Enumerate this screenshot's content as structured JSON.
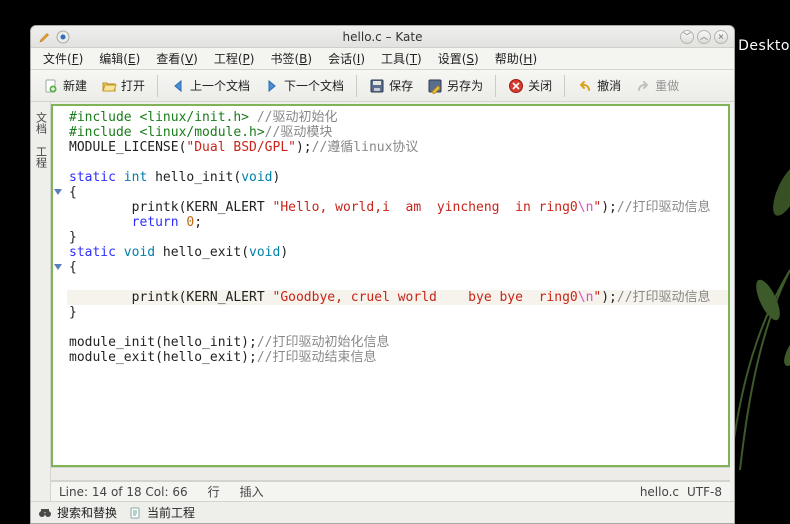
{
  "desktop_label": "Deskto",
  "title": "hello.c – Kate",
  "title_icons": {
    "edit": "pencil-icon",
    "app": "kate-icon"
  },
  "menus": [
    {
      "label": "文件",
      "accel": "F"
    },
    {
      "label": "编辑",
      "accel": "E"
    },
    {
      "label": "查看",
      "accel": "V"
    },
    {
      "label": "工程",
      "accel": "P"
    },
    {
      "label": "书签",
      "accel": "B"
    },
    {
      "label": "会话",
      "accel": "I"
    },
    {
      "label": "工具",
      "accel": "T"
    },
    {
      "label": "设置",
      "accel": "S"
    },
    {
      "label": "帮助",
      "accel": "H"
    }
  ],
  "toolbar": {
    "new": "新建",
    "open": "打开",
    "back": "上一个文档",
    "forward": "下一个文档",
    "save": "保存",
    "saveas": "另存为",
    "close": "关闭",
    "undo": "撤消",
    "redo": "重做"
  },
  "sidebar": {
    "tab1": "文档",
    "tab2": "工程"
  },
  "code": {
    "current_line_index": 13,
    "lines": [
      [
        {
          "c": "kw-pp",
          "t": "#include <linux/init.h>"
        },
        " ",
        {
          "c": "cmt",
          "t": "//驱动初始化"
        }
      ],
      [
        {
          "c": "kw-pp",
          "t": "#include <linux/module.h>"
        },
        {
          "c": "cmt",
          "t": "//驱动模块"
        }
      ],
      [
        "MODULE_LICENSE(",
        {
          "c": "str",
          "t": "\"Dual BSD/GPL\""
        },
        ");",
        {
          "c": "cmt",
          "t": "//遵循linux协议"
        }
      ],
      [
        ""
      ],
      [
        {
          "c": "kw",
          "t": "static"
        },
        " ",
        {
          "c": "type",
          "t": "int"
        },
        " hello_init(",
        {
          "c": "type",
          "t": "void"
        },
        ")"
      ],
      [
        "{"
      ],
      [
        "        printk(KERN_ALERT ",
        {
          "c": "str",
          "t": "\"Hello, world,i  am  yincheng  in ring0"
        },
        {
          "c": "esc",
          "t": "\\n"
        },
        {
          "c": "str",
          "t": "\""
        },
        ");",
        {
          "c": "cmt",
          "t": "//打印驱动信息"
        }
      ],
      [
        "        ",
        {
          "c": "kw",
          "t": "return"
        },
        " ",
        {
          "c": "num",
          "t": "0"
        },
        ";"
      ],
      [
        "}"
      ],
      [
        {
          "c": "kw",
          "t": "static"
        },
        " ",
        {
          "c": "type",
          "t": "void"
        },
        " hello_exit(",
        {
          "c": "type",
          "t": "void"
        },
        ")"
      ],
      [
        "{"
      ],
      [
        ""
      ],
      [
        "        printk(KERN_ALERT ",
        {
          "c": "str",
          "t": "\"Goodbye, cruel world    bye bye  ring0"
        },
        {
          "c": "esc",
          "t": "\\n"
        },
        {
          "c": "str",
          "t": "\""
        },
        ");",
        {
          "c": "cmt",
          "t": "//打印驱动信息"
        }
      ],
      [
        "}"
      ],
      [
        ""
      ],
      [
        "module_init(hello_init);",
        {
          "c": "cmt",
          "t": "//打印驱动初始化信息"
        }
      ],
      [
        "module_exit(hello_exit);",
        {
          "c": "cmt",
          "t": "//打印驱动结束信息"
        }
      ],
      [
        ""
      ]
    ],
    "fold_markers": [
      5,
      10
    ]
  },
  "status": {
    "pos": "Line: 14 of 18 Col: 66",
    "wrap": "行",
    "mode": "插入",
    "filename": "hello.c",
    "encoding": "UTF-8"
  },
  "bottom": {
    "search": "搜索和替换",
    "project": "当前工程"
  }
}
